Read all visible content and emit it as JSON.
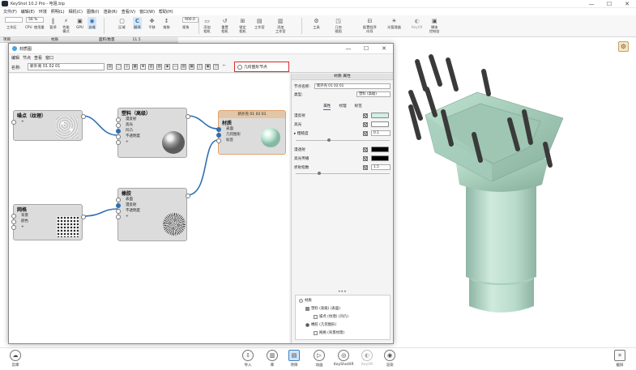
{
  "app": {
    "title": "KeyShot 10.2 Pro - 电阻.bip",
    "window_controls": [
      "—",
      "☐",
      "✕"
    ]
  },
  "menu": [
    "文件(F)",
    "编辑(E)",
    "环境",
    "照明(L)",
    "相机(C)",
    "图像(I)",
    "渲染(R)",
    "查看(V)",
    "窗口(W)",
    "帮助(H)"
  ],
  "toolbar": {
    "workspace_select": "",
    "cpu_select": "56 %",
    "zoom_select": "100 %",
    "size_select": "900.0",
    "items": [
      {
        "label": "工作区",
        "icon": "▭"
      },
      {
        "label": "CPU",
        "icon": "▦"
      },
      {
        "label": "使用量",
        "icon": ""
      },
      {
        "label": "暂停",
        "icon": "‖"
      },
      {
        "label": "性能\n模式",
        "icon": "⚡"
      },
      {
        "label": "GPU",
        "icon": "▣"
      },
      {
        "label": "去噪",
        "icon": "◉"
      },
      {
        "label": "区域",
        "icon": "▢"
      },
      {
        "label": "翻译",
        "icon": "C"
      },
      {
        "label": "平移",
        "icon": "✥"
      },
      {
        "label": "推移",
        "icon": "↕"
      },
      {
        "label": "视角",
        "icon": "◢"
      },
      {
        "label": "添加\n相机",
        "icon": "▭"
      },
      {
        "label": "重置\n相机",
        "icon": "↺"
      },
      {
        "label": "锁定\n相机",
        "icon": "⊞"
      },
      {
        "label": "工作室",
        "icon": "▤"
      },
      {
        "label": "添加\n工作室",
        "icon": "▥"
      },
      {
        "label": "工具",
        "icon": "⚙"
      },
      {
        "label": "几何\n视图",
        "icon": "◳"
      },
      {
        "label": "配置程序\n向导",
        "icon": "⊟"
      },
      {
        "label": "光管理器",
        "icon": "☀"
      },
      {
        "label": "KeyVR",
        "icon": "◐"
      },
      {
        "label": "脚本\n控制台",
        "icon": "▣"
      }
    ]
  },
  "substrip": {
    "left": "项目",
    "mid": "材质",
    "right_label": "面积/数量",
    "right_value": "11.5"
  },
  "material_graph": {
    "window_title": "材质图",
    "menu": [
      "编辑",
      "节点",
      "查看",
      "窗口"
    ],
    "name_label": "名称:",
    "name_value": "新外壳 01 02 01",
    "geometry_button": "几何图形节点",
    "nodes": {
      "noise": {
        "title": "噪点（纹理）",
        "rows": [
          "+"
        ]
      },
      "plastic": {
        "title": "塑料（高级）",
        "rows": [
          "漫反射",
          "高光",
          "凹凸",
          "不透明度",
          "+"
        ]
      },
      "mesh": {
        "title": "网格",
        "rows": [
          "背景",
          "颜色",
          "+"
        ]
      },
      "rubber": {
        "title": "橡胶",
        "rows": [
          "表面",
          "漫反射",
          "不透明度",
          "+"
        ]
      },
      "material": {
        "header": "新外壳 01 02 01",
        "title": "材质",
        "rows": [
          "表面",
          "几何图形",
          "标签"
        ]
      }
    },
    "props": {
      "header": "材质 属性",
      "node_name_label": "节点名称:",
      "node_name_value": "新外壳 01 02 01",
      "type_label": "类型:",
      "type_value": "塑料 (高级)",
      "tabs": [
        "属性",
        "纹理",
        "标签"
      ],
      "diffuse_label": "漫反射",
      "diffuse_color": "#cdf1e2",
      "specular_label": "高光",
      "roughness_label": "▸ 粗糙度",
      "roughness_value": "0.1",
      "transmission_label": "漫透射",
      "specular_trans_label": "高光传播",
      "ior_label": "折射指数",
      "ior_value": "1.5",
      "tree": [
        {
          "label": "材质",
          "indent": 0
        },
        {
          "label": "塑料 (高级) (表面)",
          "indent": 1
        },
        {
          "label": "噪点 (纹理) (凹凸)",
          "indent": 2
        },
        {
          "label": "橡胶 (几何图形)",
          "indent": 1
        },
        {
          "label": "网格 (背景纹理)",
          "indent": 2
        }
      ]
    }
  },
  "bottom": {
    "left": {
      "label": "云库",
      "icon": "☁"
    },
    "items": [
      {
        "label": "导入",
        "icon": "⇩"
      },
      {
        "label": "库",
        "icon": "▥"
      },
      {
        "label": "项目",
        "icon": "▤"
      },
      {
        "label": "动画",
        "icon": "▷"
      },
      {
        "label": "KeyShotXR",
        "icon": "◎"
      },
      {
        "label": "KeyVR",
        "icon": "◐"
      },
      {
        "label": "渲染",
        "icon": "◉"
      }
    ],
    "right": {
      "label": "截屏",
      "icon": "⌗"
    }
  },
  "colors": {
    "model": "#b5dcc9",
    "pins": "#3a3a3a",
    "accent": "#2f6fb3",
    "highlight": "#d9292b"
  }
}
